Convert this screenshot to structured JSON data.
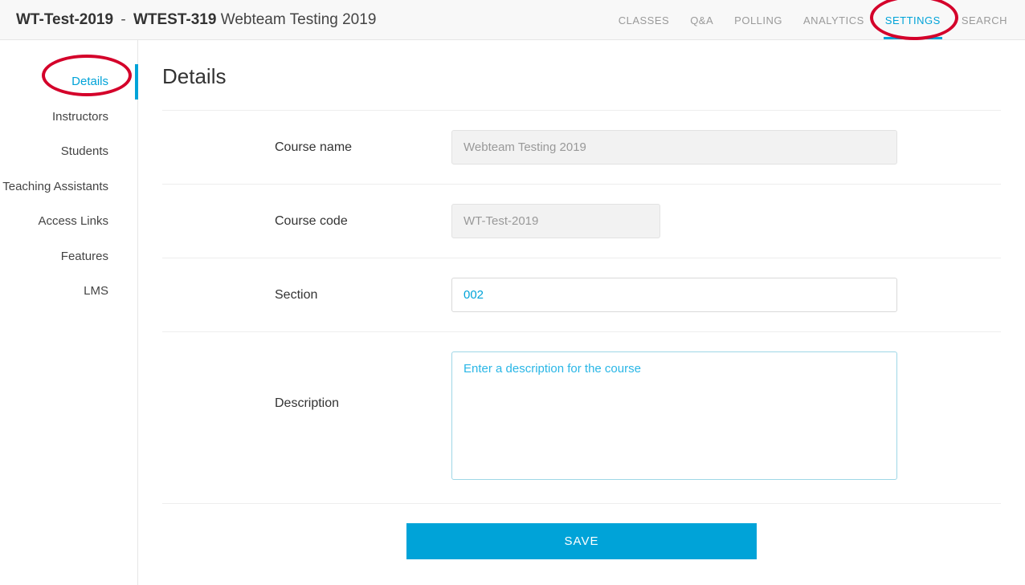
{
  "breadcrumb": {
    "course_code": "WT-Test-2019",
    "course_section_id": "WTEST-319",
    "course_name": "Webteam Testing 2019"
  },
  "topnav": {
    "items": [
      {
        "label": "CLASSES"
      },
      {
        "label": "Q&A"
      },
      {
        "label": "POLLING"
      },
      {
        "label": "ANALYTICS"
      },
      {
        "label": "SETTINGS"
      },
      {
        "label": "SEARCH"
      }
    ],
    "active_index": 4
  },
  "sidebar": {
    "items": [
      {
        "label": "Details"
      },
      {
        "label": "Instructors"
      },
      {
        "label": "Students"
      },
      {
        "label": "Teaching Assistants"
      },
      {
        "label": "Access Links"
      },
      {
        "label": "Features"
      },
      {
        "label": "LMS"
      }
    ],
    "active_index": 0
  },
  "page": {
    "title": "Details"
  },
  "form": {
    "course_name": {
      "label": "Course name",
      "value": "Webteam Testing 2019"
    },
    "course_code": {
      "label": "Course code",
      "value": "WT-Test-2019"
    },
    "section": {
      "label": "Section",
      "value": "002"
    },
    "description": {
      "label": "Description",
      "placeholder": "Enter a description for the course",
      "value": ""
    }
  },
  "buttons": {
    "save": "SAVE"
  }
}
